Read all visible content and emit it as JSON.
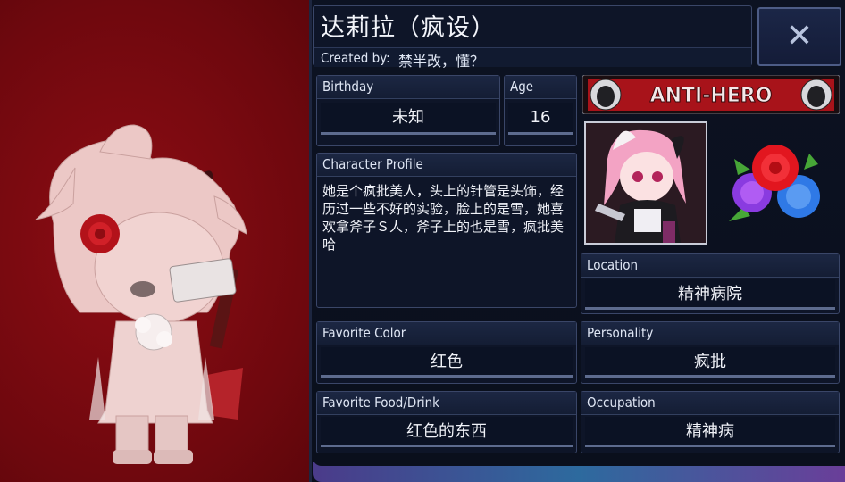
{
  "profile": {
    "title": "达莉拉（疯设）",
    "created_label": "Created by:",
    "created_value": "禁半改，懂？",
    "close_icon": "close-icon",
    "badge_text": "ANTI-HERO",
    "fields": {
      "birthday": {
        "label": "Birthday",
        "value": "未知"
      },
      "age": {
        "label": "Age",
        "value": "16"
      },
      "character_profile": {
        "label": "Character Profile",
        "value": "她是个疯批美人，头上的针管是头饰，经历过一些不好的实验，脸上的是雪，她喜欢拿斧子Ｓ人，斧子上的也是雪，疯批美哈"
      },
      "location": {
        "label": "Location",
        "value": "精神病院"
      },
      "favorite_color": {
        "label": "Favorite Color",
        "value": "红色"
      },
      "personality": {
        "label": "Personality",
        "value": "疯批"
      },
      "favorite_food": {
        "label": "Favorite Food/Drink",
        "value": "红色的东西"
      },
      "occupation": {
        "label": "Occupation",
        "value": "精神病"
      }
    }
  },
  "colors": {
    "background_red": "#7a0a10",
    "panel_dark": "#0c1222",
    "accent_border": "#3a4668",
    "badge_red": "#c0171d"
  },
  "icons": [
    "close-icon",
    "anti-hero-badge",
    "character-avatar",
    "rose-emblem",
    "character-figure"
  ]
}
